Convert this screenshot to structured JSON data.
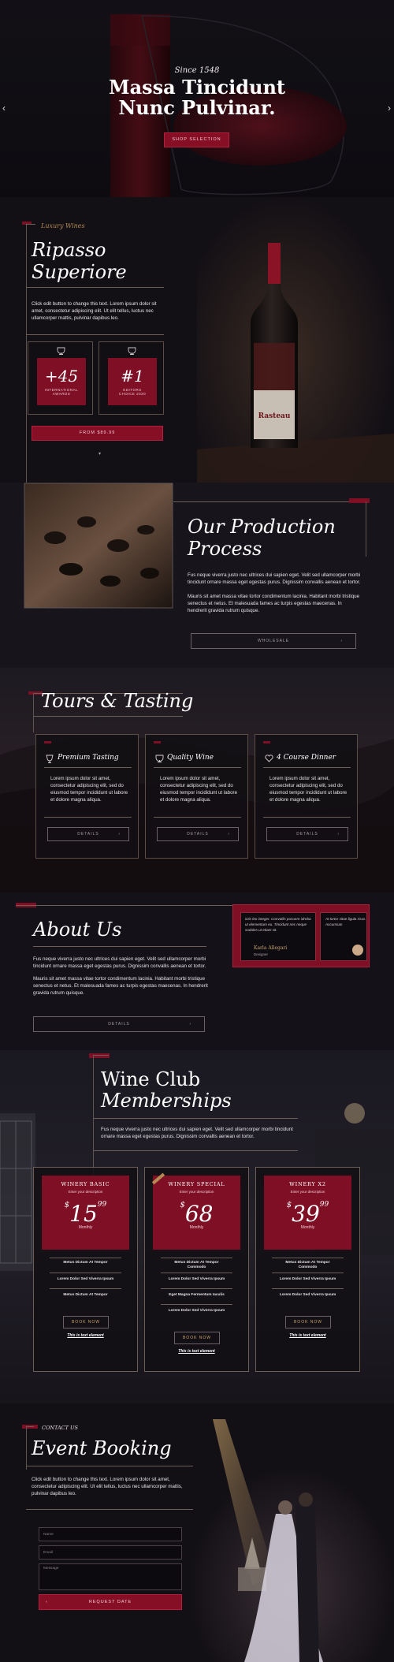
{
  "hero": {
    "since": "Since 1548",
    "title_line1": "Massa Tincidunt",
    "title_line2": "Nunc Pulvinar.",
    "button": "SHOP SELECTION"
  },
  "ripasso": {
    "kicker": "Luxury Wines",
    "title_line1": "Ripasso",
    "title_line2": "Superiore",
    "text": "Click edit button to change this text. Lorem ipsum dolor sit amet, consectetur adipiscing elit. Ut elit tellus, luctus nec ullamcorper mattis, pulvinar dapibus leo.",
    "awards": [
      {
        "value": "+45",
        "label1": "INTERNATIONAL",
        "label2": "AWARDS"
      },
      {
        "value": "#1",
        "label1": "EDITORS",
        "label2": "CHOICE 2020"
      }
    ],
    "price_button": "FROM $89.99",
    "label_brand": "Rasteau"
  },
  "production": {
    "title_line1": "Our Production",
    "title_line2": "Process",
    "p1": "Fus neque viverra justo nec ultrices dui sapien eget. Velit sed ullamcorper morbi tincidunt ornare massa eget egestas purus. Dignissim convallis aenean et tortor.",
    "p2": "Mauris sit amet massa vitae tortor condimentum lacinia. Habitant morbi tristique senectus et netus. Et malesuada fames ac turpis egestas maecenas. In hendrerit gravida rutrum quisque.",
    "button": "WHOLESALE"
  },
  "tours": {
    "title": "Tours & Tasting",
    "cards": [
      {
        "title": "Premium Tasting",
        "text": "Lorem ipsum dolor sit amet, consectetur adipiscing elit, sed do eiusmod tempor incididunt ut labore et dolore magna aliqua.",
        "button": "DETAILS"
      },
      {
        "title": "Quality Wine",
        "text": "Lorem ipsum dolor sit amet, consectetur adipiscing elit, sed do eiusmod tempor incididunt ut labore et dolore magna aliqua.",
        "button": "DETAILS"
      },
      {
        "title": "4 Course Dinner",
        "text": "Lorem ipsum dolor sit amet, consectetur adipiscing elit, sed do eiusmod tempor incididunt ut labore et dolore magna aliqua.",
        "button": "DETAILS"
      }
    ]
  },
  "about": {
    "title": "About Us",
    "p1": "Fus neque viverra justo nec ultrices dui sapien eget. Velit sed ullamcorper morbi tincidunt ornare massa eget egestas purus. Dignissim convallis aenean et tortor.",
    "p2": "Mauris sit amet massa vitae tortor condimentum lacinia. Habitant morbi tristique senectus et netus. Et malesuada fames ac turpis egestas maecenas. In hendrerit gravida rutrum quisque.",
    "button": "DETAILS",
    "testimonial1_text": "ictis leo integer. Convallis posuere idreba ut elementum eu. Tincidunt nec neque sodales ut etiam sit.",
    "testimonial1_name": "Karla Allegari",
    "testimonial1_role": "Designer",
    "testimonial2_text": "At tortor vitae ligula risus. Accumsan"
  },
  "club": {
    "title_line1": "Wine Club",
    "title_line2": "Memberships",
    "text": "Fus neque viverra justo nec ultrices dui sapien eget. Velit sed ullamcorper morbi tincidunt ornare massa eget egestas purus. Dignissim convallis aenean et tortor.",
    "plans": [
      {
        "name": "WINERY BASIC",
        "desc": "Enter your description",
        "currency": "$",
        "price": "15",
        "cents": "99",
        "period": "Monthly",
        "features": [
          "Metus Dictum At Tempor",
          "Lorem Dolor Sed Viverra Ipsum",
          "Metus Dictum At Tempor"
        ],
        "button": "BOOK NOW",
        "link": "This is text element"
      },
      {
        "name": "WINERY SPECIAL",
        "desc": "Enter your description",
        "currency": "$",
        "price": "68",
        "cents": "",
        "period": "Monthly",
        "ribbon": "Popular",
        "features": [
          "Metus Dictum At Tempor Commodo",
          "Lorem Dolor Sed Viverra Ipsum",
          "Eget Magna Fermentum Iaculis",
          "Lorem Dolor Sed Viverra Ipsum"
        ],
        "button": "BOOK NOW",
        "link": "This is text element"
      },
      {
        "name": "WINERY X2",
        "desc": "Enter your description",
        "currency": "$",
        "price": "39",
        "cents": "99",
        "period": "Monthly",
        "features": [
          "Metus Dictum At Tempor Commodo",
          "Lorem Dolor Sed Viverra Ipsum",
          "Lorem Dolor Sed Viverra Ipsum"
        ],
        "button": "BOOK NOW",
        "link": "This is text element"
      }
    ]
  },
  "booking": {
    "kicker": "CONTACT US",
    "title": "Event Booking",
    "text": "Click edit button to change this text. Lorem ipsum dolor sit amet, consectetur adipiscing elit. Ut elit tellus, luctus nec ullamcorper mattis, pulvinar dapibus leo.",
    "name_placeholder": "Name",
    "email_placeholder": "Email",
    "message_placeholder": "Message",
    "button": "REQUEST DATE"
  }
}
